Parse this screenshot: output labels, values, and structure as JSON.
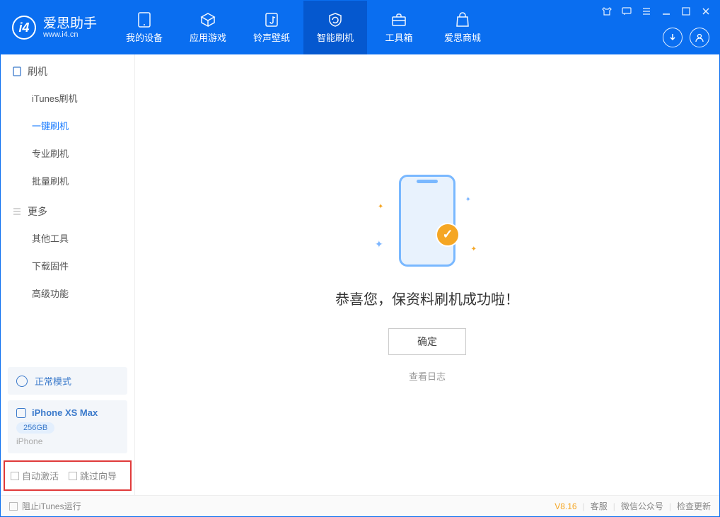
{
  "app": {
    "name": "爱思助手",
    "url": "www.i4.cn"
  },
  "nav": {
    "items": [
      {
        "label": "我的设备"
      },
      {
        "label": "应用游戏"
      },
      {
        "label": "铃声壁纸"
      },
      {
        "label": "智能刷机"
      },
      {
        "label": "工具箱"
      },
      {
        "label": "爱思商城"
      }
    ]
  },
  "sidebar": {
    "flash": {
      "title": "刷机",
      "items": [
        {
          "label": "iTunes刷机"
        },
        {
          "label": "一键刷机"
        },
        {
          "label": "专业刷机"
        },
        {
          "label": "批量刷机"
        }
      ]
    },
    "more": {
      "title": "更多",
      "items": [
        {
          "label": "其他工具"
        },
        {
          "label": "下载固件"
        },
        {
          "label": "高级功能"
        }
      ]
    },
    "mode": {
      "label": "正常模式"
    },
    "device": {
      "name": "iPhone XS Max",
      "storage": "256GB",
      "type": "iPhone"
    },
    "options": {
      "auto_activate": "自动激活",
      "skip_wizard": "跳过向导"
    }
  },
  "main": {
    "success_text": "恭喜您，保资料刷机成功啦！",
    "ok_button": "确定",
    "view_log": "查看日志"
  },
  "footer": {
    "block_itunes": "阻止iTunes运行",
    "version": "V8.16",
    "links": {
      "support": "客服",
      "wechat": "微信公众号",
      "update": "检查更新"
    }
  }
}
